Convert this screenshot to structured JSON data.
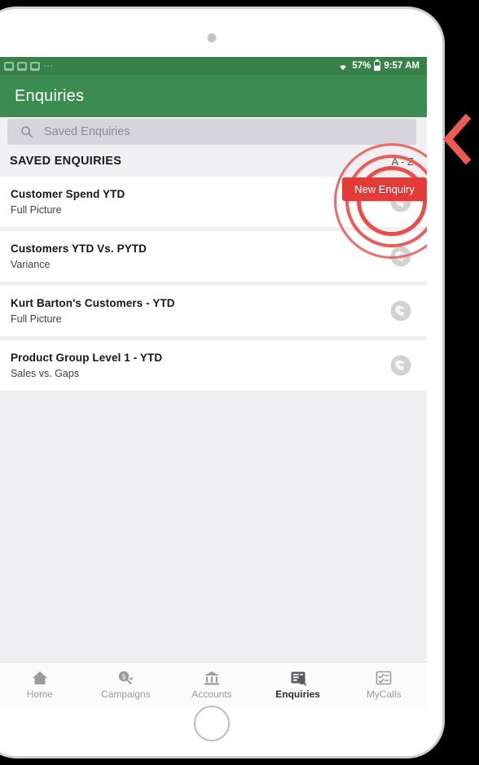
{
  "device": {
    "camera_icon": "camera-dot",
    "home_button_icon": "home-circle-button"
  },
  "status_bar": {
    "notification_icons": [
      "notification-icon",
      "image-icon",
      "notification-icon"
    ],
    "overflow_icon": "more-dots-icon",
    "wifi_icon": "wifi-icon",
    "battery_percent": "57%",
    "battery_icon": "battery-icon",
    "time": "9:57 AM"
  },
  "app_bar": {
    "title": "Enquiries"
  },
  "search": {
    "icon": "search-icon",
    "placeholder": "Saved Enquiries",
    "value": ""
  },
  "section": {
    "title": "SAVED ENQUIRIES",
    "sort_label": "A - Z"
  },
  "actions": {
    "new_enquiry_label": "New Enquiry"
  },
  "list": {
    "items": [
      {
        "title": "Customer Spend YTD",
        "subtitle": "Full Picture",
        "icon": "globe-icon"
      },
      {
        "title": "Customers YTD Vs. PYTD",
        "subtitle": "Variance",
        "icon": "globe-icon"
      },
      {
        "title": "Kurt Barton's Customers - YTD",
        "subtitle": "Full Picture",
        "icon": "globe-icon"
      },
      {
        "title": "Product Group Level 1 - YTD",
        "subtitle": "Sales vs. Gaps",
        "icon": "globe-icon"
      }
    ]
  },
  "bottom_nav": {
    "items": [
      {
        "label": "Home",
        "icon": "home-icon",
        "active": false
      },
      {
        "label": "Campaigns",
        "icon": "campaign-magnifier-icon",
        "active": false
      },
      {
        "label": "Accounts",
        "icon": "bank-icon",
        "active": false
      },
      {
        "label": "Enquiries",
        "icon": "database-search-icon",
        "active": true
      },
      {
        "label": "MyCalls",
        "icon": "checklist-icon",
        "active": false
      }
    ]
  },
  "annotation": {
    "chevron_icon": "chevron-left-icon",
    "highlight_icon": "pulse-rings-highlight"
  },
  "colors": {
    "status_bar_green": "#388049",
    "app_bar_green": "#3c8c51",
    "accent_red": "#e23b38",
    "ring_red": "#ef5a56",
    "screen_bg": "#f0f0f2",
    "card_bg": "#ffffff",
    "search_bg": "#d6d5dc",
    "nav_inactive": "#9a9a9f",
    "nav_active": "#2c2c30"
  }
}
